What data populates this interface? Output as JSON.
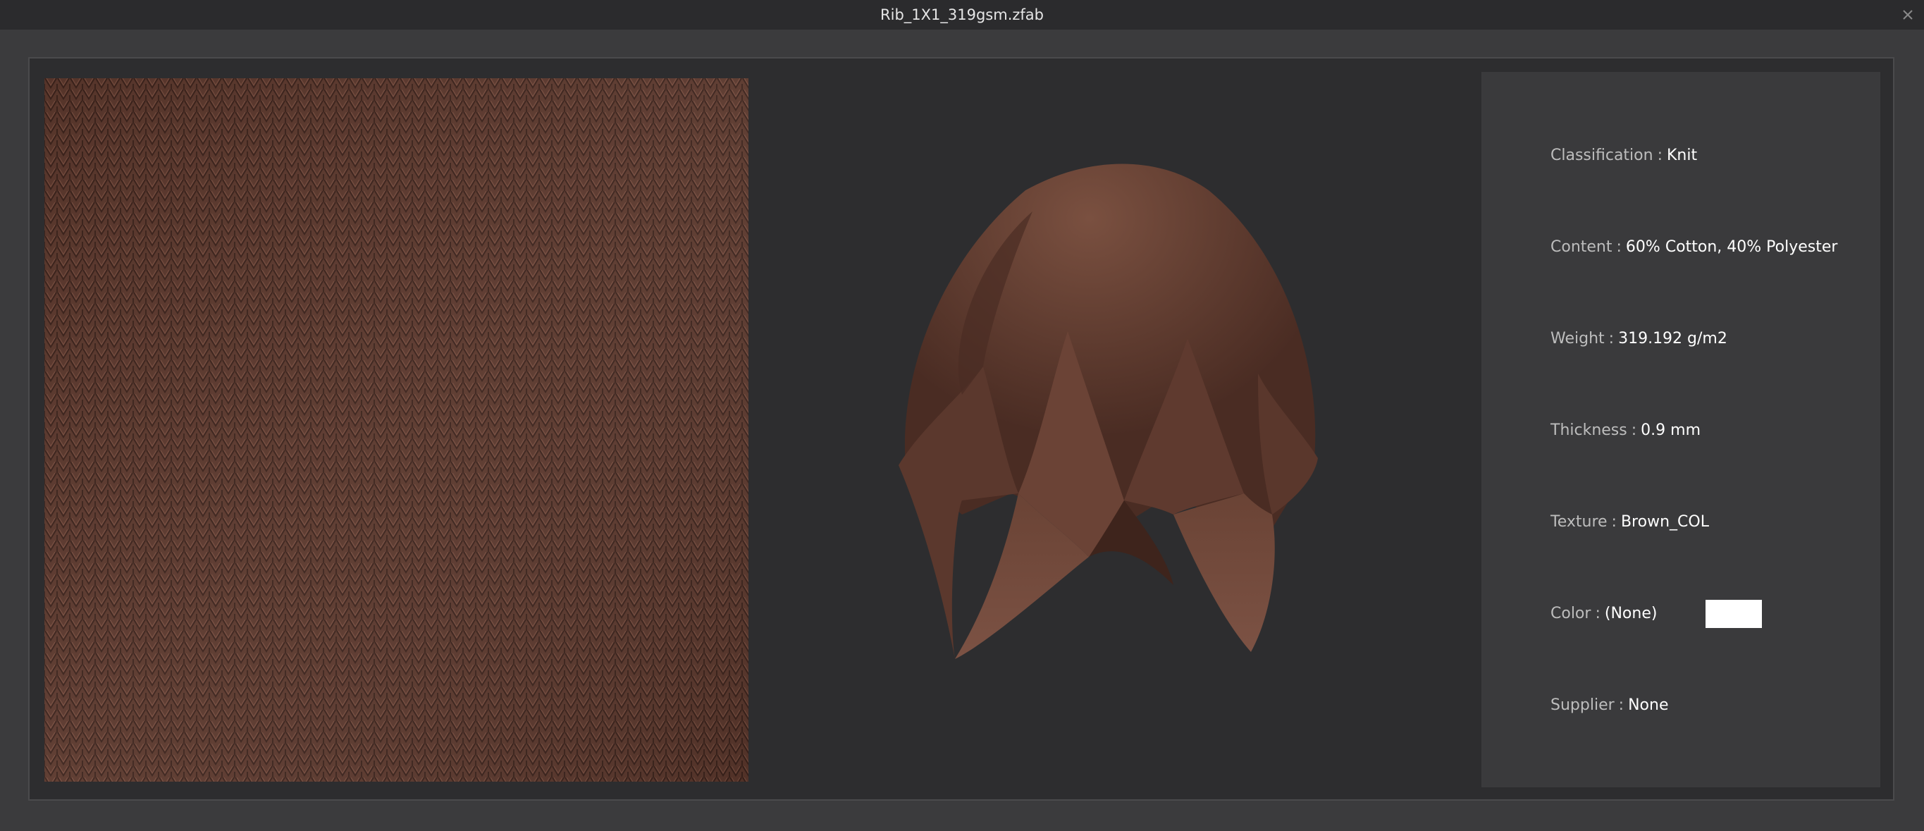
{
  "window": {
    "title": "Rib_1X1_319gsm.zfab",
    "close_glyph": "✕"
  },
  "fabric": {
    "swatch_color": "#5a372c",
    "drape_color": "#6e463a"
  },
  "info": {
    "separator": ":",
    "classification": {
      "label": "Classification",
      "value": "Knit"
    },
    "content": {
      "label": "Content",
      "value": "60% Cotton, 40% Polyester"
    },
    "weight": {
      "label": "Weight",
      "value": "319.192 g/m2"
    },
    "thickness": {
      "label": "Thickness",
      "value": "0.9 mm"
    },
    "texture": {
      "label": "Texture",
      "value": "Brown_COL"
    },
    "color": {
      "label": "Color",
      "value": "(None)",
      "swatch": "#ffffff"
    },
    "supplier": {
      "label": "Supplier",
      "value": "None"
    }
  }
}
